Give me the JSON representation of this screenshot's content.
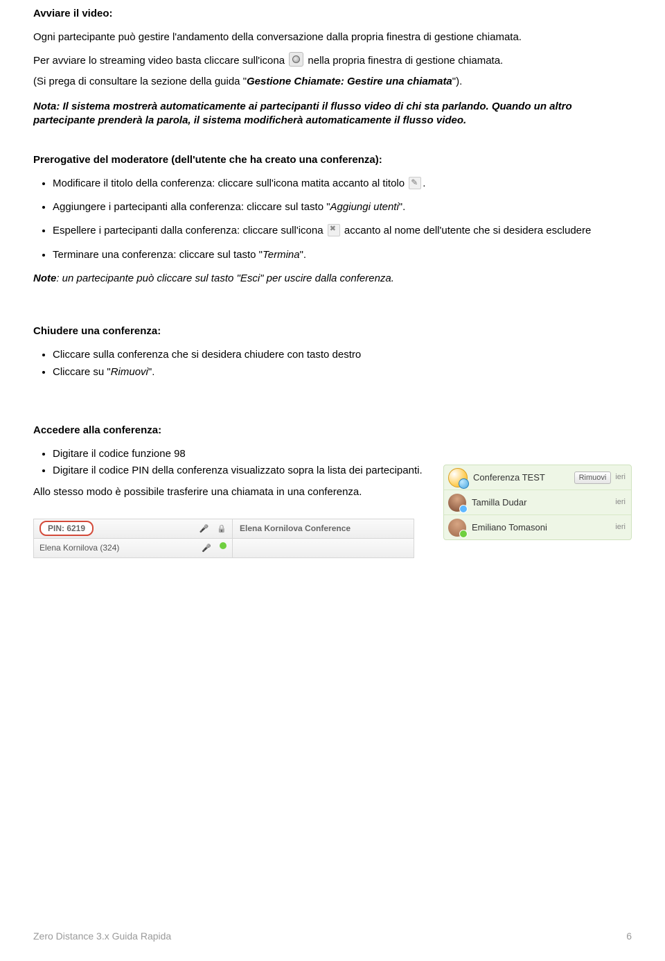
{
  "h_avviare": "Avviare il video:",
  "p_intro": "Ogni partecipante può gestire l'andamento della conversazione dalla propria finestra di gestione chiamata.",
  "p_stream_a": "Per avviare lo streaming video basta cliccare sull'icona",
  "p_stream_b": "nella propria finestra di gestione chiamata.",
  "p_consult_a": "(Si prega di consultare la sezione della guida \"",
  "p_consult_em": "Gestione Chiamate: Gestire una chiamata",
  "p_consult_b": "\").",
  "p_nota": "Nota: Il sistema mostrerà automaticamente ai partecipanti il flusso video di chi sta parlando. Quando un altro partecipante prenderà la parola, il sistema modificherà automaticamente il flusso video.",
  "h_prerog": "Prerogative del moderatore (dell'utente che ha creato una conferenza):",
  "li_mod_a": "Modificare il titolo della conferenza: cliccare sull'icona matita accanto al titolo",
  "li_mod_b": ".",
  "li_agg_a": "Aggiungere i partecipanti alla conferenza: cliccare sul tasto \"",
  "li_agg_em": "Aggiungi utenti",
  "li_agg_b": "\".",
  "li_esp_a": "Espellere i partecipanti dalla conferenza: cliccare sull'icona",
  "li_esp_b": "accanto al nome dell'utente che si desidera escludere",
  "li_term_a": "Terminare una conferenza: cliccare sul tasto \"",
  "li_term_em": "Termina",
  "li_term_b": "\".",
  "p_note2_a": "Note",
  "p_note2_b": ": un partecipante può cliccare sul tasto \"Esci\" per uscire dalla conferenza.",
  "h_chiudere": "Chiudere una conferenza:",
  "li_chi1": "Cliccare sulla conferenza che si desidera chiudere con tasto destro",
  "li_chi2_a": "Cliccare su \"",
  "li_chi2_em": "Rimuovi",
  "li_chi2_b": "\".",
  "h_accedere": "Accedere alla conferenza:",
  "li_acc1": "Digitare il codice funzione 98",
  "li_acc2": "Digitare il codice PIN della conferenza visualizzato sopra la lista dei partecipanti.",
  "p_trasf": "Allo stesso modo è possibile trasferire una chiamata in una conferenza.",
  "conf_list": {
    "rows": [
      {
        "name": "Conferenza TEST",
        "time": "ieri",
        "button": "Rimuovi"
      },
      {
        "name": "Tamilla Dudar",
        "time": "ieri"
      },
      {
        "name": "Emiliano Tomasoni",
        "time": "ieri"
      }
    ]
  },
  "pin_widget": {
    "pin_label": "PIN: 6219",
    "conf_title": "Elena Kornilova Conference",
    "participant": "Elena Kornilova (324)"
  },
  "footer_left": "Zero Distance 3.x Guida Rapida",
  "footer_right": "6"
}
